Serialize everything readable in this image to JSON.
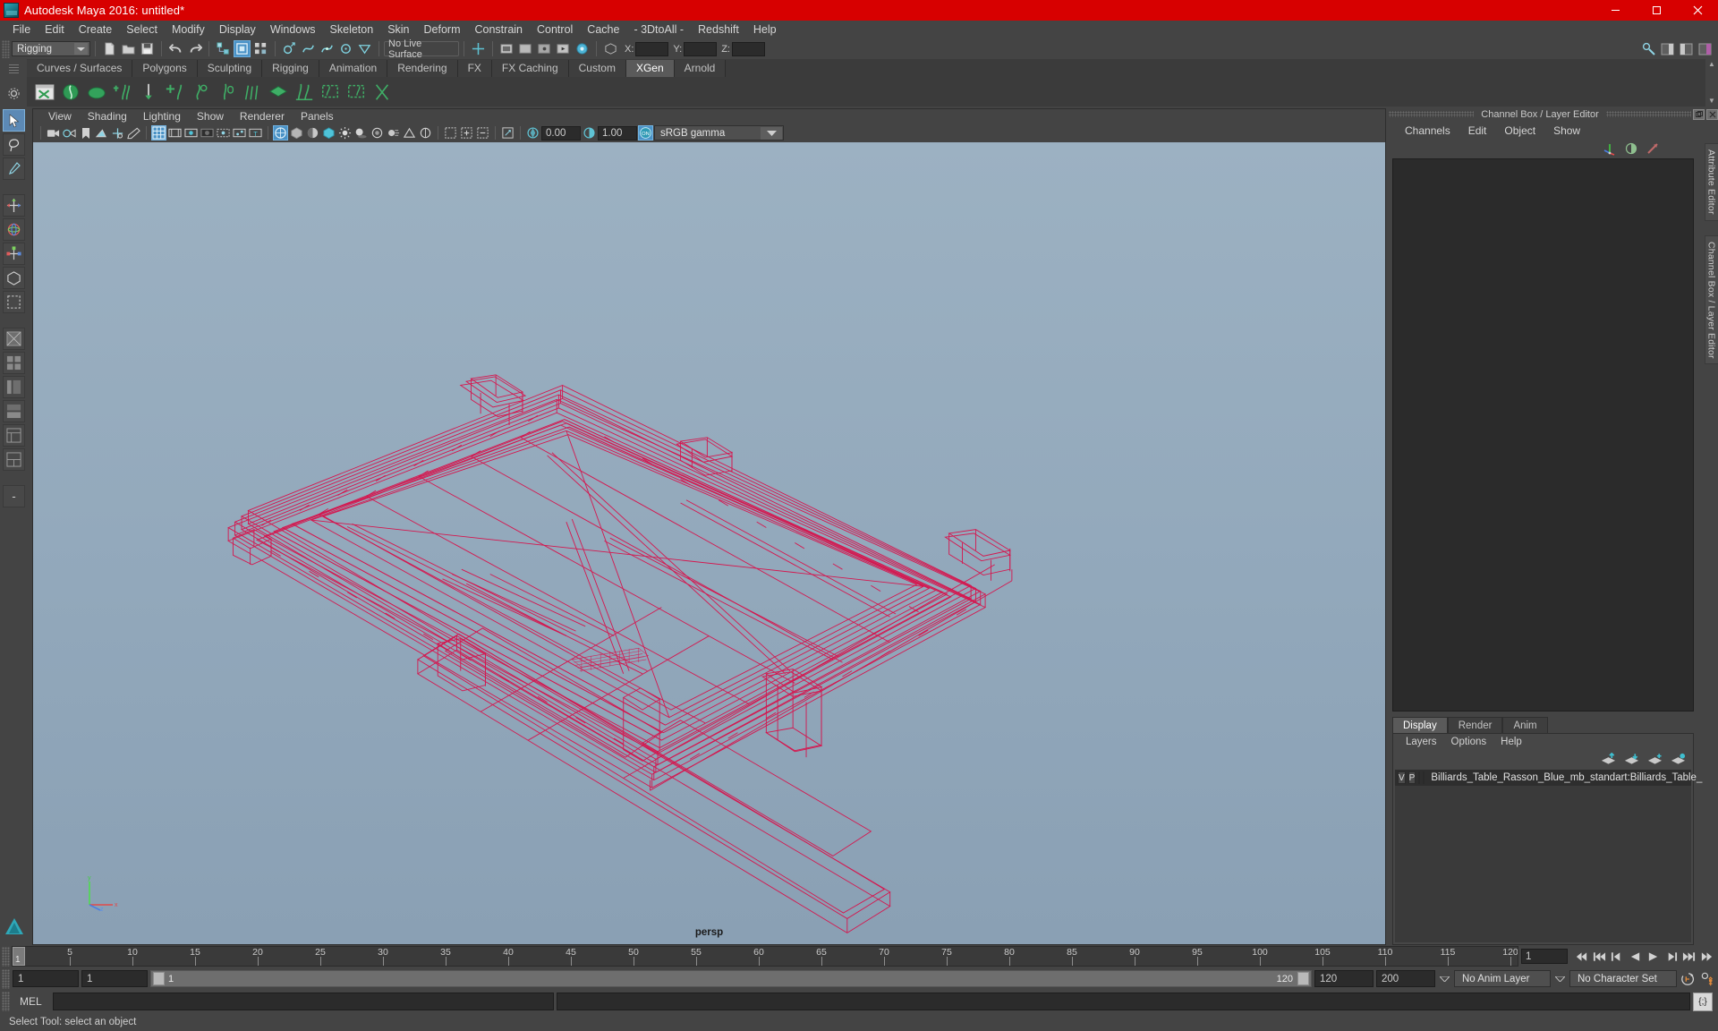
{
  "window": {
    "title": "Autodesk Maya 2016: untitled*",
    "minimize": "—",
    "maximize": "▢",
    "close": "✕"
  },
  "menubar": {
    "items": [
      "File",
      "Edit",
      "Create",
      "Select",
      "Modify",
      "Display",
      "Windows",
      "Skeleton",
      "Skin",
      "Deform",
      "Constrain",
      "Control",
      "Cache",
      "- 3DtoAll -",
      "Redshift",
      "Help"
    ]
  },
  "statusline": {
    "menu_set": "Rigging",
    "live_surface": "No Live Surface",
    "x_label": "X:",
    "y_label": "Y:",
    "z_label": "Z:",
    "x_value": "",
    "y_value": "",
    "z_value": ""
  },
  "shelf": {
    "tabs": [
      "Curves / Surfaces",
      "Polygons",
      "Sculpting",
      "Rigging",
      "Animation",
      "Rendering",
      "FX",
      "FX Caching",
      "Custom",
      "XGen",
      "Arnold"
    ],
    "active_tab": "XGen"
  },
  "viewport_panel": {
    "menus": [
      "View",
      "Shading",
      "Lighting",
      "Show",
      "Renderer",
      "Panels"
    ],
    "exposure_value": "0.00",
    "gamma_value": "1.00",
    "view_transform": "sRGB gamma",
    "camera_label": "persp"
  },
  "channel_box": {
    "dock_title": "Channel Box / Layer Editor",
    "menus": [
      "Channels",
      "Edit",
      "Object",
      "Show"
    ]
  },
  "layer_editor": {
    "tabs": [
      "Display",
      "Render",
      "Anim"
    ],
    "active_tab": "Display",
    "menus": [
      "Layers",
      "Options",
      "Help"
    ],
    "layers": [
      {
        "visibility": "V",
        "playback": "P",
        "reference": "",
        "color": "#b3143c",
        "name": "Billiards_Table_Rasson_Blue_mb_standart:Billiards_Table_"
      }
    ]
  },
  "side_tabs": [
    "Attribute Editor",
    "Channel Box / Layer Editor"
  ],
  "time_slider": {
    "current_frame": "1",
    "current_frame_field": "1",
    "ticks": [
      5,
      10,
      15,
      20,
      25,
      30,
      35,
      40,
      45,
      50,
      55,
      60,
      65,
      70,
      75,
      80,
      85,
      90,
      95,
      100,
      105,
      110,
      115,
      120
    ],
    "start": 1,
    "end": 120
  },
  "range_slider": {
    "range_start": "1",
    "anim_start": "1",
    "playback_start_label": "1",
    "playback_end_label": "120",
    "anim_end": "120",
    "range_end": "200",
    "anim_layer": "No Anim Layer",
    "character_set": "No Character Set"
  },
  "command_line": {
    "label": "MEL",
    "input_value": "",
    "output_value": ""
  },
  "help_line": {
    "text": "Select Tool: select an object"
  },
  "colors": {
    "title_bar": "#d70000",
    "accent_blue": "#4a92c6",
    "panel_bg": "#444444",
    "wireframe_red": "#d8104a",
    "layer_swatch": "#b3143c"
  }
}
